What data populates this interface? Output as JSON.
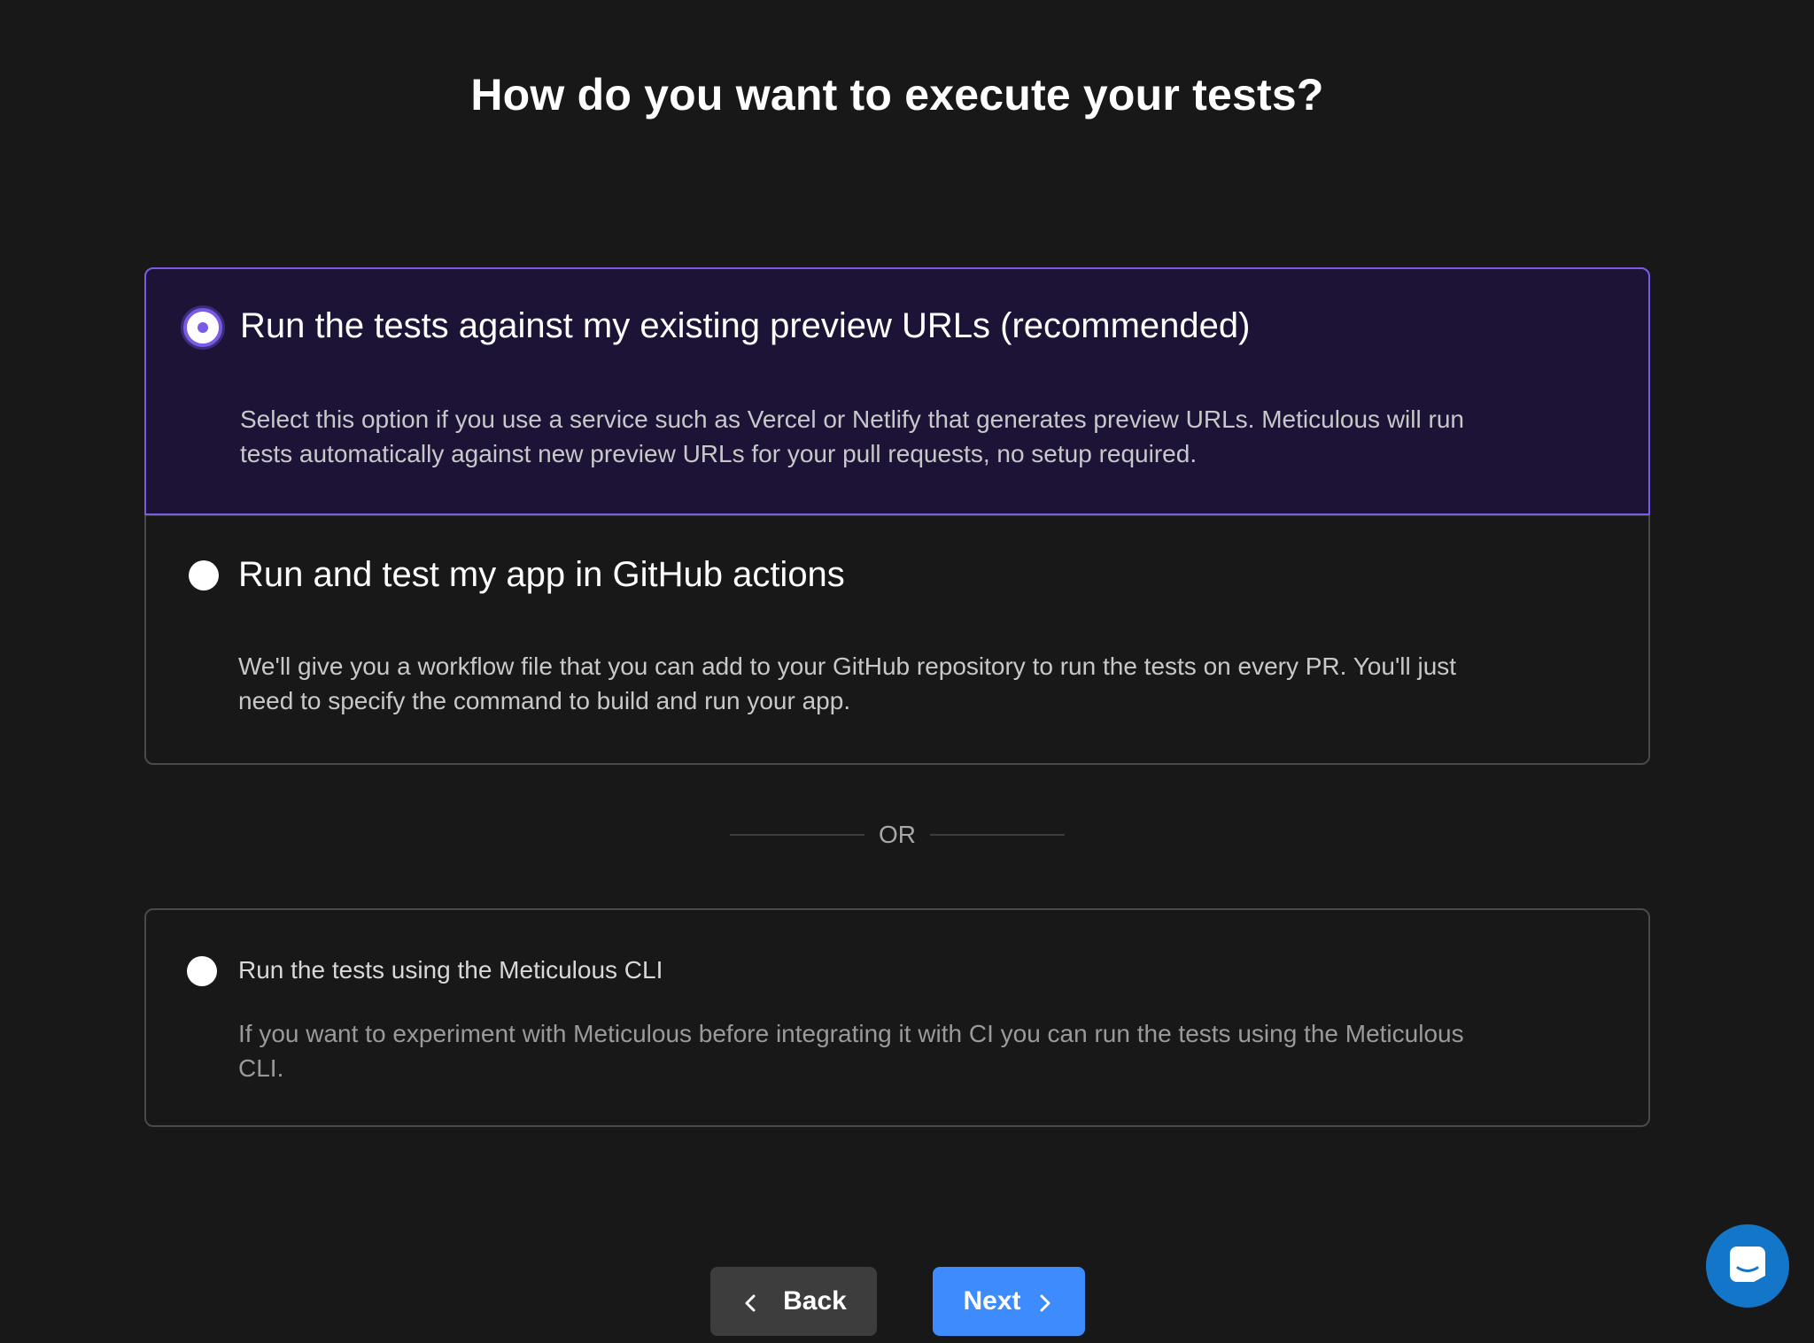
{
  "page": {
    "title": "How do you want to execute your tests?"
  },
  "options": [
    {
      "title": "Run the tests against my existing preview URLs (recommended)",
      "description": "Select this option if you use a service such as Vercel or Netlify that generates preview URLs. Meticulous will run tests automatically against new preview URLs for your pull requests, no setup required.",
      "selected": true
    },
    {
      "title": "Run and test my app in GitHub actions",
      "description": "We'll give you a workflow file that you can add to your GitHub repository to run the tests on every PR. You'll just need to specify the command to build and run your app.",
      "selected": false
    }
  ],
  "divider": {
    "label": "OR"
  },
  "cli_option": {
    "title": "Run the tests using the Meticulous CLI",
    "description": "If you want to experiment with Meticulous before integrating it with CI you can run the tests using the Meticulous CLI.",
    "selected": false
  },
  "buttons": {
    "back_label": "Back",
    "next_label": "Next"
  },
  "colors": {
    "background": "#181818",
    "selected_bg": "#1d1337",
    "accent_purple": "#7b5ae8",
    "primary_blue": "#3d8bfd",
    "chat_blue": "#1476c8"
  },
  "icons": {
    "back": "chevron-left-icon",
    "next": "chevron-right-icon",
    "chat": "chat-icon"
  }
}
